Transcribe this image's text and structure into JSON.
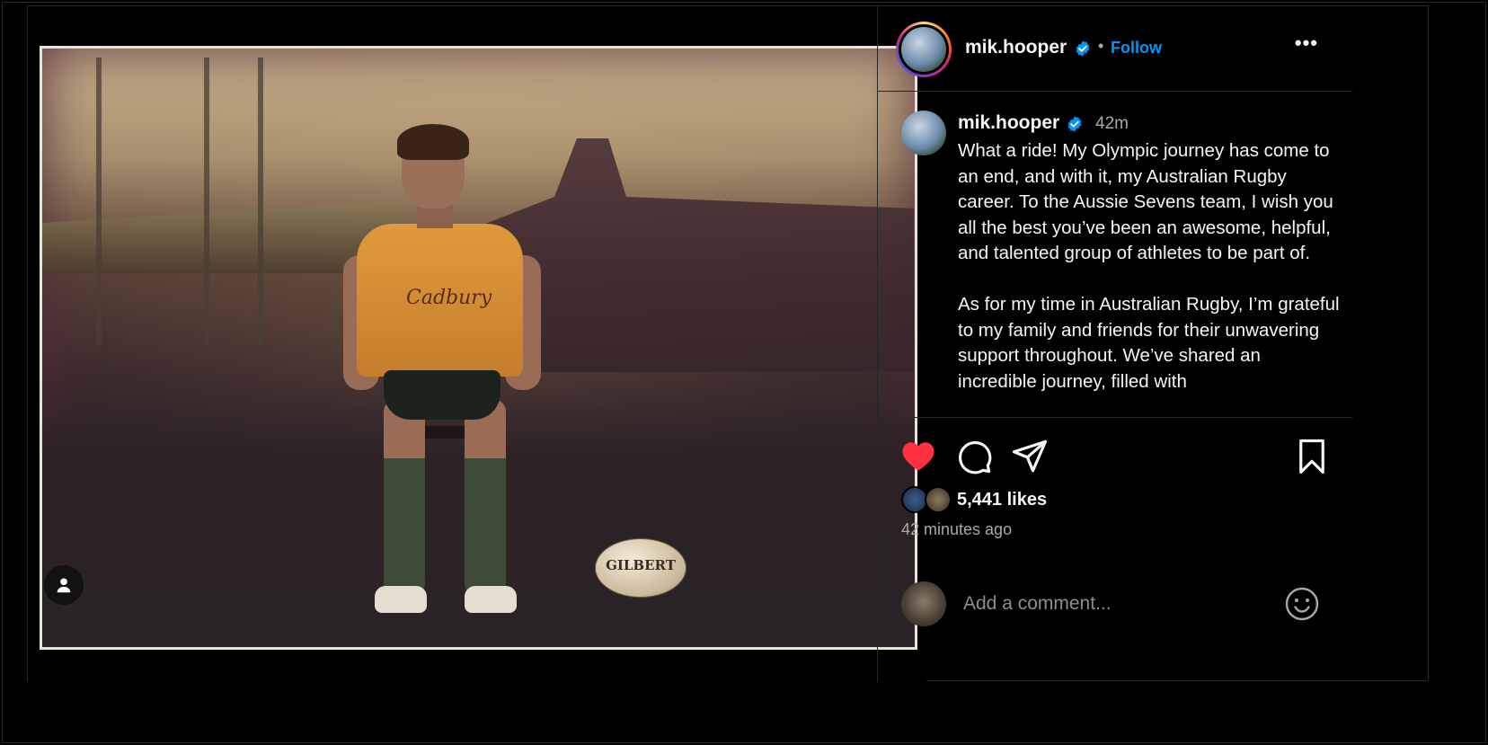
{
  "post": {
    "media": {
      "jersey_text": "Cadbury",
      "ball_text": "GILBERT"
    },
    "header": {
      "username": "mik.hooper",
      "separator": "•",
      "follow_label": "Follow",
      "more_label": "•••"
    },
    "caption": {
      "username": "mik.hooper",
      "time": "42m",
      "text": "What a ride! My Olympic journey has come to an end, and with it, my Australian Rugby career. To the Aussie Sevens team, I wish you all the best you’ve been an awesome, helpful, and talented group of athletes to be part of.\n\nAs for my time in Australian Rugby, I’m grateful to my family and friends for their unwavering support throughout. We’ve shared an incredible journey, filled with"
    },
    "actions": {
      "liked": true,
      "like_color": "#ff3040"
    },
    "likes": {
      "count_label": "5,441 likes"
    },
    "timestamp": "42 minutes ago",
    "comment": {
      "placeholder": "Add a comment..."
    },
    "colors": {
      "follow": "#0095f6",
      "verified": "#0095f6",
      "background": "#000000"
    }
  }
}
